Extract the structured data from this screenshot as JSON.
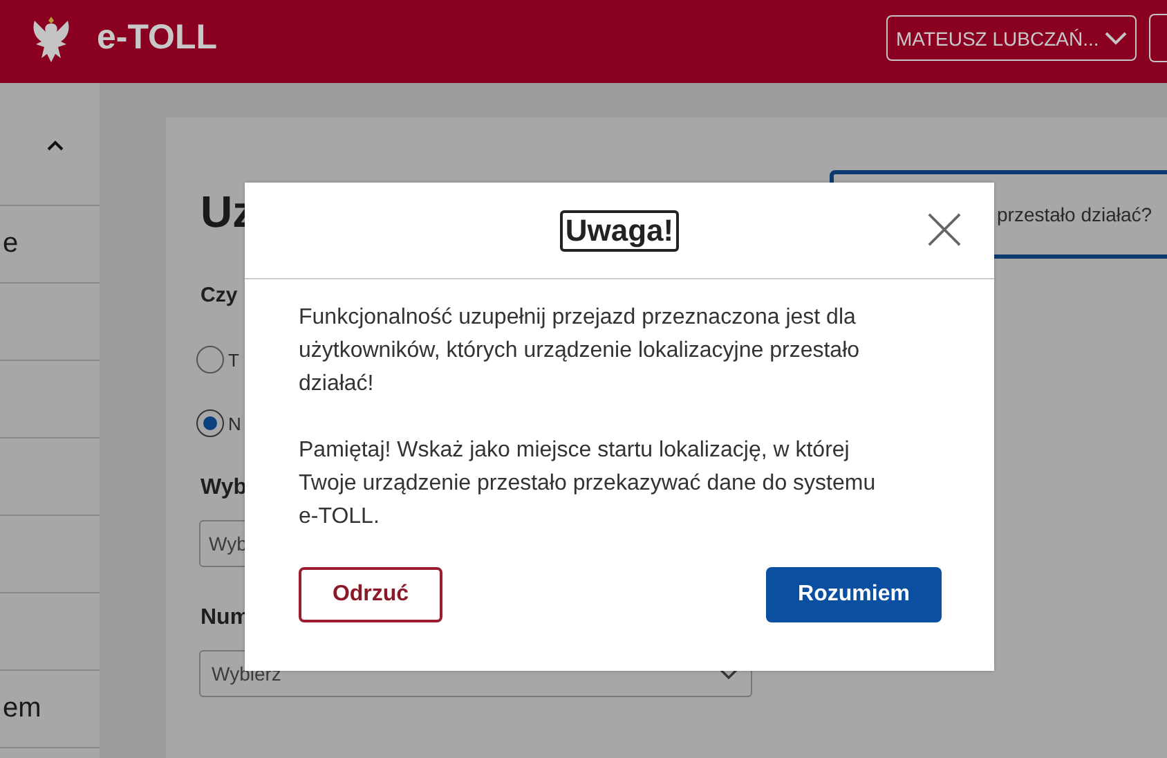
{
  "header": {
    "logo_text": "e-TOLL",
    "user_menu": "MATEUSZ LUBCZAŃ..."
  },
  "sidebar": {
    "items": [
      {
        "label": "e"
      },
      {
        "label": "em"
      }
    ]
  },
  "page": {
    "title": "Uz",
    "info_box": "przestało działać?",
    "question": "Czy",
    "options": [
      {
        "label": "T",
        "selected": false
      },
      {
        "label": "N",
        "selected": true
      }
    ],
    "field_1": {
      "label": "Wyb",
      "placeholder": "Wyb"
    },
    "field_2": {
      "label": "Num",
      "placeholder": "Wybierz"
    }
  },
  "modal": {
    "title": "Uwaga!",
    "paragraphs": [
      "Funkcjonalność uzupełnij przejazd przeznaczona jest dla użytkowników, których urządzenie lokalizacyjne przestało działać!",
      "Pamiętaj! Wskaż jako miejsce startu lokalizację, w której Twoje urządzenie przestało przekazywać dane do systemu e-TOLL."
    ],
    "buttons": [
      {
        "label": "Odrzuć",
        "kind": "secondary"
      },
      {
        "label": "Rozumiem",
        "kind": "primary"
      }
    ]
  }
}
